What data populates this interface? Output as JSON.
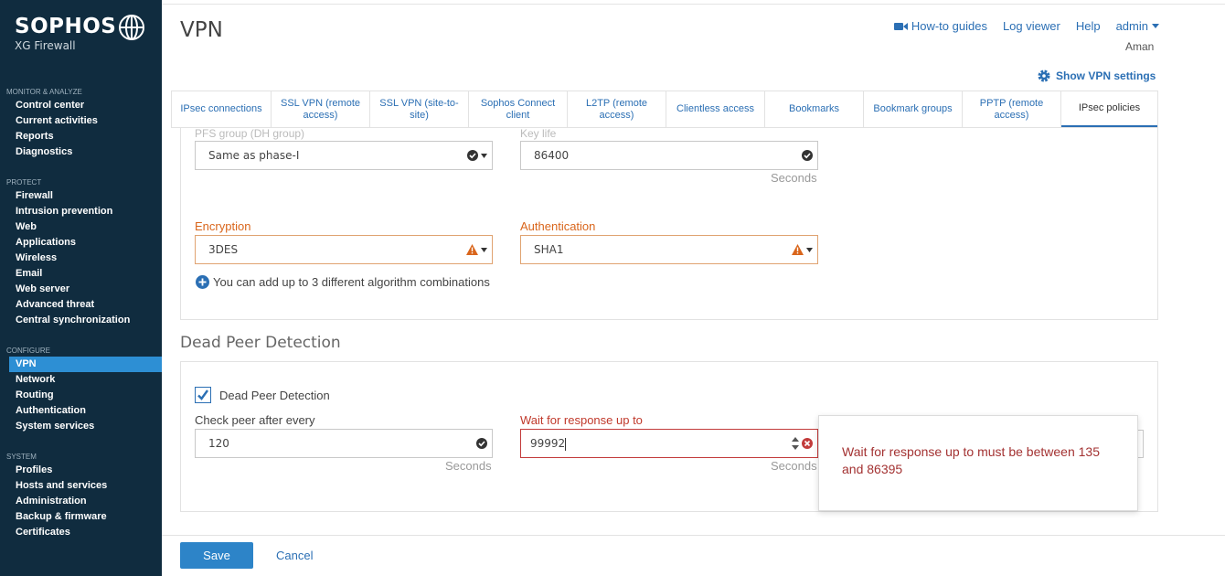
{
  "brand": {
    "name": "SOPHOS",
    "product": "XG Firewall"
  },
  "sidebar": {
    "sections": [
      {
        "heading": "MONITOR & ANALYZE",
        "items": [
          "Control center",
          "Current activities",
          "Reports",
          "Diagnostics"
        ]
      },
      {
        "heading": "PROTECT",
        "items": [
          "Firewall",
          "Intrusion prevention",
          "Web",
          "Applications",
          "Wireless",
          "Email",
          "Web server",
          "Advanced threat",
          "Central synchronization"
        ]
      },
      {
        "heading": "CONFIGURE",
        "items": [
          "VPN",
          "Network",
          "Routing",
          "Authentication",
          "System services"
        ]
      },
      {
        "heading": "SYSTEM",
        "items": [
          "Profiles",
          "Hosts and services",
          "Administration",
          "Backup & firmware",
          "Certificates"
        ]
      }
    ],
    "active_item": "VPN"
  },
  "header": {
    "title": "VPN",
    "how_to_guides": "How-to guides",
    "log_viewer": "Log viewer",
    "help": "Help",
    "admin": "admin",
    "user": "Aman",
    "show_vpn_settings": "Show VPN settings"
  },
  "tabs": [
    {
      "label": "IPsec connections",
      "active": false
    },
    {
      "label": "SSL VPN (remote access)",
      "active": false
    },
    {
      "label": "SSL VPN (site-to-site)",
      "active": false
    },
    {
      "label": "Sophos Connect client",
      "active": false
    },
    {
      "label": "L2TP (remote access)",
      "active": false
    },
    {
      "label": "Clientless access",
      "active": false
    },
    {
      "label": "Bookmarks",
      "active": false
    },
    {
      "label": "Bookmark groups",
      "active": false
    },
    {
      "label": "PPTP (remote access)",
      "active": false
    },
    {
      "label": "IPsec policies",
      "active": true
    }
  ],
  "phase2": {
    "pfs_label": "PFS group (DH group)",
    "pfs_value": "Same as phase-I",
    "key_life_label": "Key life",
    "key_life_value": "86400",
    "key_life_unit": "Seconds",
    "encryption_label": "Encryption",
    "encryption_value": "3DES",
    "authentication_label": "Authentication",
    "authentication_value": "SHA1",
    "add_combo_text": "You can add up to 3 different algorithm combinations"
  },
  "dpd": {
    "section_title": "Dead Peer Detection",
    "checkbox_label": "Dead Peer Detection",
    "checked": true,
    "check_peer_label": "Check peer after every",
    "check_peer_value": "120",
    "check_peer_unit": "Seconds",
    "wait_label": "Wait for response up to",
    "wait_value": "99992",
    "wait_unit": "Seconds",
    "error_message": "Wait for response up to must be between 135 and 86395"
  },
  "footer": {
    "save": "Save",
    "cancel": "Cancel"
  },
  "colors": {
    "sidebar": "#102c3f",
    "accent": "#2b6fb4",
    "warning": "#d9651b",
    "error": "#c23b3b"
  }
}
